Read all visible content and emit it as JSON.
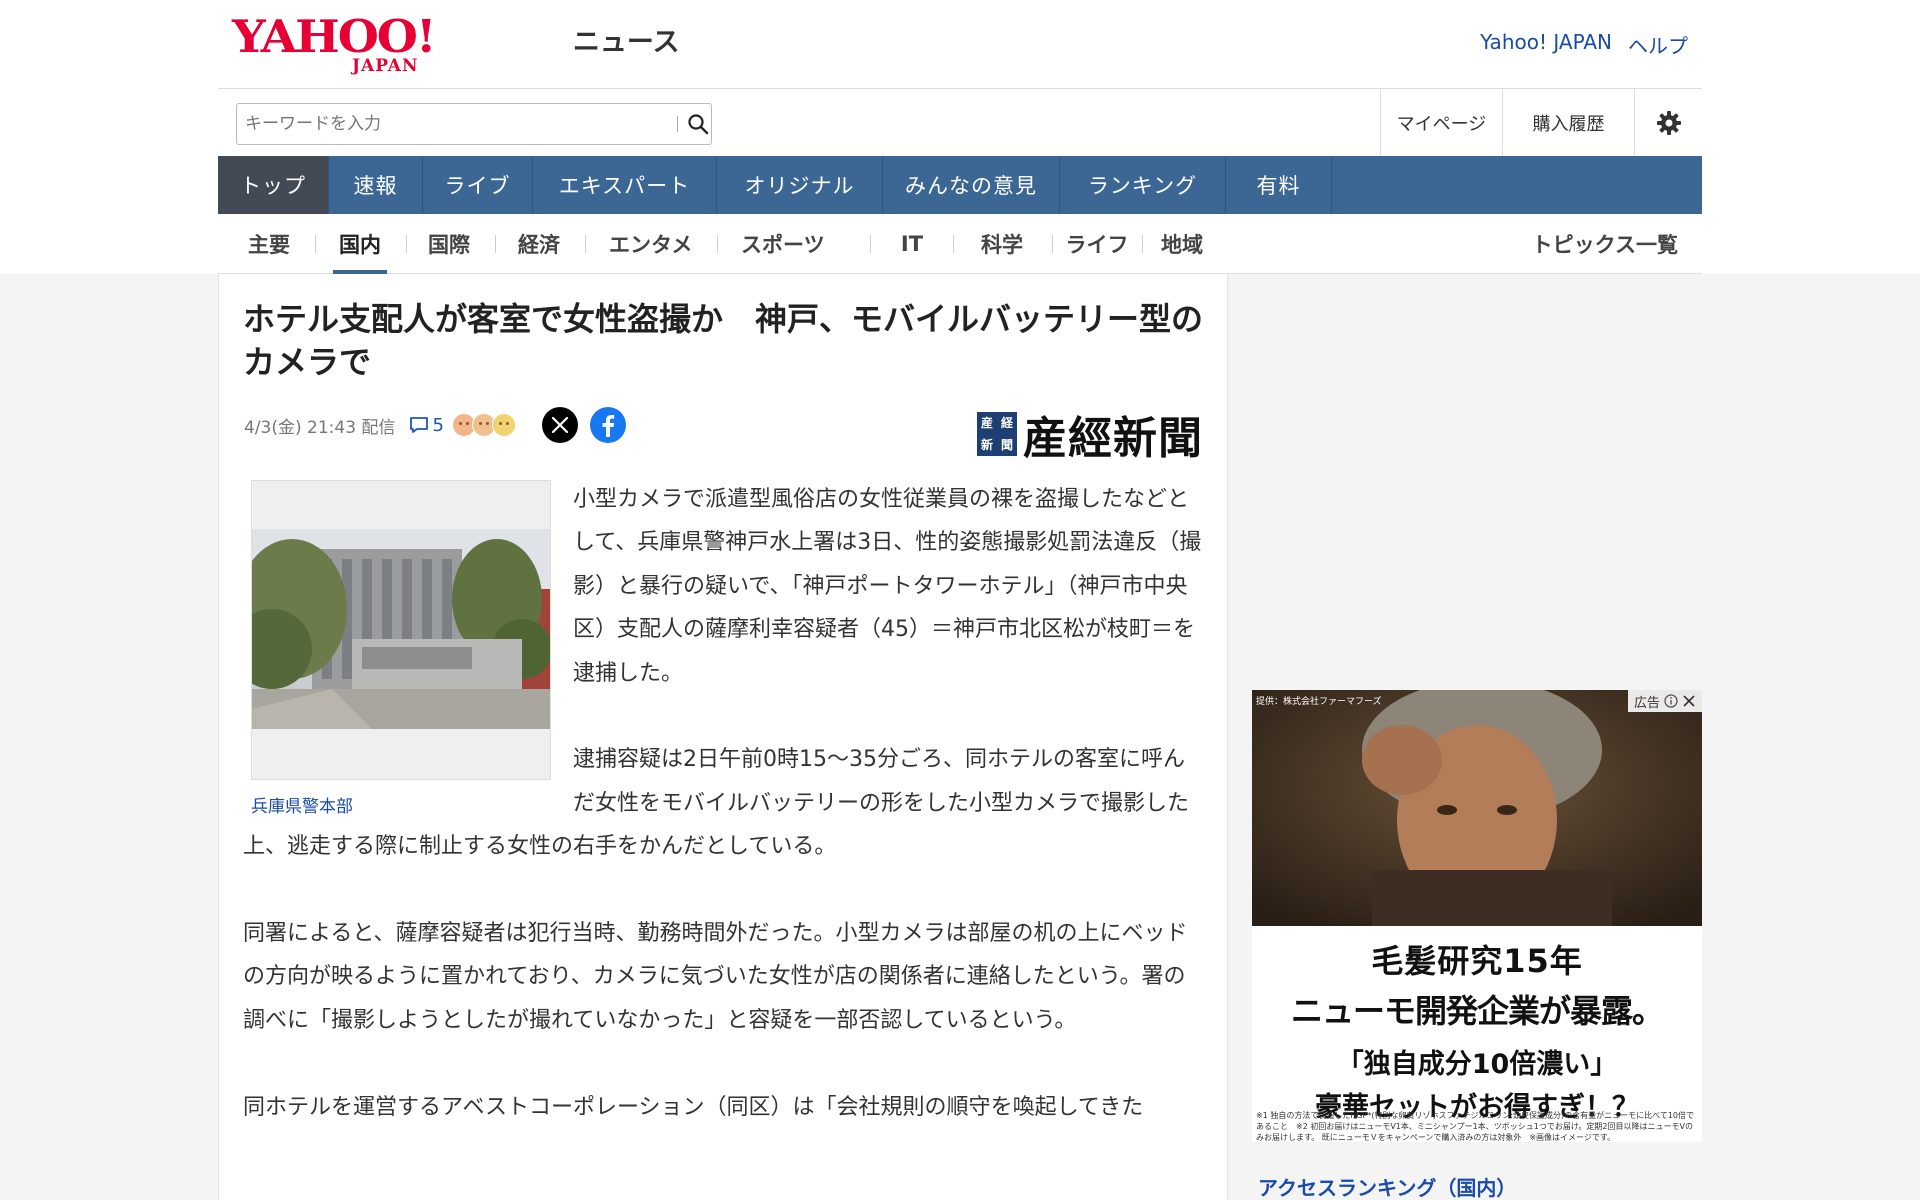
{
  "header": {
    "logo_text": "YAHOO!",
    "logo_sub": "JAPAN",
    "service_name": "ニュース",
    "links": [
      "Yahoo! JAPAN",
      "ヘルプ"
    ]
  },
  "search": {
    "placeholder": "キーワードを入力"
  },
  "tools": {
    "mypage": "マイページ",
    "history": "購入履歴"
  },
  "main_nav": [
    {
      "label": "トップ",
      "active": true
    },
    {
      "label": "速報"
    },
    {
      "label": "ライブ"
    },
    {
      "label": "エキスパート"
    },
    {
      "label": "オリジナル"
    },
    {
      "label": "みんなの意見"
    },
    {
      "label": "ランキング"
    },
    {
      "label": "有料"
    }
  ],
  "sub_nav": [
    {
      "label": "主要"
    },
    {
      "label": "国内",
      "active": true
    },
    {
      "label": "国際"
    },
    {
      "label": "経済"
    },
    {
      "label": "エンタメ"
    },
    {
      "label": "スポーツ"
    },
    {
      "label": "IT"
    },
    {
      "label": "科学"
    },
    {
      "label": "ライフ"
    },
    {
      "label": "地域"
    }
  ],
  "topics_link": "トピックス一覧",
  "article": {
    "title": "ホテル支配人が客室で女性盗撮か　神戸、モバイルバッテリー型のカメラで",
    "date": "4/3(金) 21:43 配信",
    "comment_count": "5",
    "publisher": "産經新聞",
    "publisher_seal": [
      "産",
      "経",
      "新",
      "聞"
    ],
    "photo_caption": "兵庫県警本部",
    "paragraphs": [
      "小型カメラで派遣型風俗店の女性従業員の裸を盗撮したなどとして、兵庫県警神戸水上署は3日、性的姿態撮影処罰法違反（撮影）と暴行の疑いで、「神戸ポートタワーホテル」（神戸市中央区）支配人の薩摩利幸容疑者（45）＝神戸市北区松が枝町＝を逮捕した。",
      "逮捕容疑は2日午前0時15～35分ごろ、同ホテルの客室に呼んだ女性をモバイルバッテリーの形をした小型カメラで撮影した上、逃走する際に制止する女性の右手をかんだとしている。",
      "同署によると、薩摩容疑者は犯行当時、勤務時間外だった。小型カメラは部屋の机の上にベッドの方向が映るように置かれており、カメラに気づいた女性が店の関係者に連絡したという。署の調べに「撮影しようとしたが撮れていなかった」と容疑を一部否認しているという。",
      "同ホテルを運営するアベストコーポレーション（同区）は「会社規則の順守を喚起してきた"
    ]
  },
  "ad": {
    "provider": "提供：株式会社ファーマフーズ",
    "label": "広告",
    "line1": "毛髪研究15年",
    "line2": "ニューモ開発企業が暴露。",
    "line3": "「独自成分10倍濃い」",
    "line4": "豪華セットがお得すぎ！？",
    "note": "※1 独自の方法で製造したHGP*(特別な卵黄リゾホスファチジルコリン:頭皮保護成分)の含有量がニューモに比べて10倍であること　※2 初回お届けはニューモV1本、ミニシャンプー1本、ツボッシュ1つでお届け。定期2回目以降はニューモVのみお届けします。 既にニューモＶをキャンペーンで購入済みの方は対象外　※画像はイメージです。"
  },
  "ranking_title": "アクセスランキング（国内）",
  "colors": {
    "nav_bg": "#3c6795",
    "nav_active": "#444a55",
    "link": "#1a4ba8",
    "logo_red": "#e60033"
  }
}
